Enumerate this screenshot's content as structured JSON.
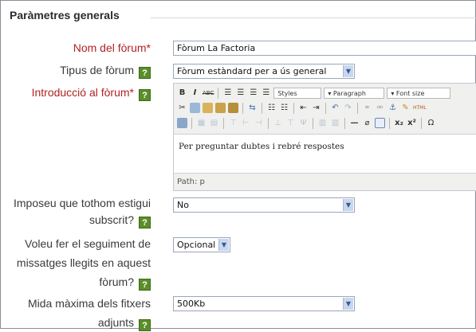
{
  "fieldset": {
    "legend": "Paràmetres generals"
  },
  "fields": {
    "forum_name": {
      "label": "Nom del fòrum*",
      "value": "Fòrum La Factoria"
    },
    "forum_type": {
      "label": "Tipus de fòrum",
      "value": "Fòrum estàndard per a ús general"
    },
    "intro": {
      "label": "Introducció al fòrum*",
      "toolbar": {
        "bold": "B",
        "italic": "I",
        "strike": "ABC",
        "styles": "Styles",
        "paragraph": "Paragraph",
        "font_size": "Font size",
        "subscript": "x₂",
        "superscript": "x²"
      },
      "content": "Per preguntar dubtes i rebré respostes",
      "path": "Path: p"
    },
    "subscribe": {
      "label_line1": "Imposeu que tothom estigui",
      "label_line2": "subscrit?",
      "value": "No"
    },
    "tracking": {
      "label_line1": "Voleu fer el seguiment de",
      "label_line2": "missatges llegits en aquest",
      "label_line3": "fòrum?",
      "value": "Opcional"
    },
    "max_attach": {
      "label_line1": "Mida màxima dels fitxers",
      "label_line2": "adjunts",
      "value": "500Kb"
    }
  },
  "help_icon": "?",
  "colors": {
    "required_label": "#b22222",
    "help_bg": "#5a8e2a",
    "legend": "#2b2b2b"
  }
}
